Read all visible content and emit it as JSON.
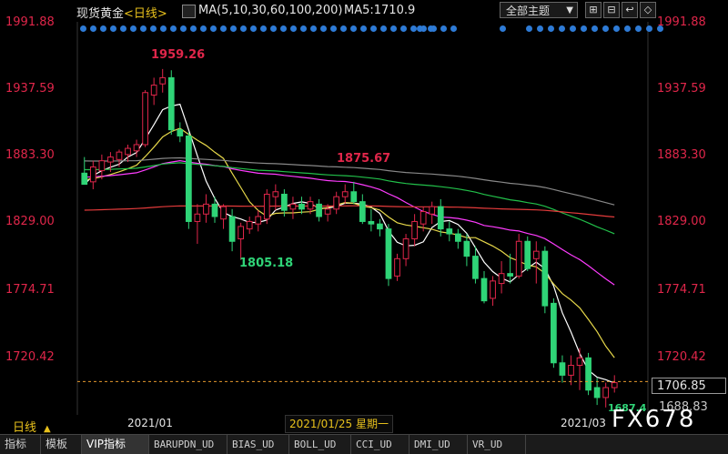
{
  "header": {
    "symbol": "现货黄金",
    "period_label": "<日线>",
    "ma_params": "MA(5,10,30,60,100,200)",
    "ma5_value": "MA5:1710.9",
    "theme_button": "全部主题",
    "tool_buttons": [
      "⊞",
      "⊟",
      "↩",
      "◇"
    ]
  },
  "y_axis": {
    "left_labels": [
      "1991.88",
      "1937.59",
      "1883.30",
      "1829.00",
      "1774.71",
      "1720.42"
    ],
    "right_labels": [
      "1991.88",
      "1937.59",
      "1883.30",
      "1829.00",
      "1774.71",
      "1720.42"
    ]
  },
  "current_price": "1706.85",
  "price_box_lower": "1688.83",
  "annotations": {
    "high": "1959.26",
    "mid_high": "1875.67",
    "low": "1805.18",
    "recent_low": "1687.4"
  },
  "x_axis": {
    "period_button": "日线",
    "date_labels": [
      "2021/01",
      "2021/03"
    ],
    "cursor_label": "2021/01/25 星期一"
  },
  "watermark": "FX678",
  "tabs": [
    "指标",
    "模板",
    "VIP指标",
    "BARUPDN_UD",
    "BIAS_UD",
    "BOLL_UD",
    "CCI_UD",
    "DMI_UD",
    "VR_UD"
  ],
  "active_tab": "VIP指标",
  "colors": {
    "up": "#e0264a",
    "down": "#2fd477",
    "ma5": "#ffffff",
    "ma10": "#e7d84a",
    "ma30": "#ff3cff",
    "ma60": "#22c04a",
    "ma100": "#888888",
    "ma200": "#e43b3b",
    "axis_text": "#e0264a"
  },
  "chart_data": {
    "type": "candlestick",
    "y_range": [
      1680,
      2000
    ],
    "candles": [
      {
        "o": 1875,
        "h": 1888,
        "l": 1868,
        "c": 1866
      },
      {
        "o": 1868,
        "h": 1885,
        "l": 1862,
        "c": 1880
      },
      {
        "o": 1877,
        "h": 1890,
        "l": 1870,
        "c": 1885
      },
      {
        "o": 1884,
        "h": 1892,
        "l": 1876,
        "c": 1888
      },
      {
        "o": 1886,
        "h": 1894,
        "l": 1880,
        "c": 1892
      },
      {
        "o": 1890,
        "h": 1898,
        "l": 1884,
        "c": 1895
      },
      {
        "o": 1893,
        "h": 1902,
        "l": 1888,
        "c": 1898
      },
      {
        "o": 1898,
        "h": 1942,
        "l": 1896,
        "c": 1940
      },
      {
        "o": 1938,
        "h": 1952,
        "l": 1930,
        "c": 1946
      },
      {
        "o": 1947,
        "h": 1959,
        "l": 1940,
        "c": 1952
      },
      {
        "o": 1952,
        "h": 1958,
        "l": 1906,
        "c": 1910
      },
      {
        "o": 1910,
        "h": 1916,
        "l": 1900,
        "c": 1905
      },
      {
        "o": 1905,
        "h": 1908,
        "l": 1830,
        "c": 1836
      },
      {
        "o": 1836,
        "h": 1850,
        "l": 1818,
        "c": 1842
      },
      {
        "o": 1842,
        "h": 1858,
        "l": 1835,
        "c": 1850
      },
      {
        "o": 1850,
        "h": 1856,
        "l": 1835,
        "c": 1840
      },
      {
        "o": 1838,
        "h": 1850,
        "l": 1830,
        "c": 1848
      },
      {
        "o": 1840,
        "h": 1846,
        "l": 1812,
        "c": 1820
      },
      {
        "o": 1822,
        "h": 1835,
        "l": 1805,
        "c": 1832
      },
      {
        "o": 1830,
        "h": 1840,
        "l": 1826,
        "c": 1836
      },
      {
        "o": 1834,
        "h": 1845,
        "l": 1828,
        "c": 1840
      },
      {
        "o": 1838,
        "h": 1862,
        "l": 1834,
        "c": 1858
      },
      {
        "o": 1856,
        "h": 1866,
        "l": 1845,
        "c": 1860
      },
      {
        "o": 1858,
        "h": 1862,
        "l": 1840,
        "c": 1845
      },
      {
        "o": 1846,
        "h": 1856,
        "l": 1838,
        "c": 1850
      },
      {
        "o": 1850,
        "h": 1856,
        "l": 1842,
        "c": 1846
      },
      {
        "o": 1846,
        "h": 1856,
        "l": 1842,
        "c": 1852
      },
      {
        "o": 1850,
        "h": 1854,
        "l": 1836,
        "c": 1840
      },
      {
        "o": 1842,
        "h": 1850,
        "l": 1836,
        "c": 1846
      },
      {
        "o": 1846,
        "h": 1860,
        "l": 1842,
        "c": 1856
      },
      {
        "o": 1856,
        "h": 1866,
        "l": 1850,
        "c": 1860
      },
      {
        "o": 1860,
        "h": 1868,
        "l": 1850,
        "c": 1852
      },
      {
        "o": 1852,
        "h": 1858,
        "l": 1834,
        "c": 1836
      },
      {
        "o": 1836,
        "h": 1846,
        "l": 1828,
        "c": 1834
      },
      {
        "o": 1834,
        "h": 1838,
        "l": 1824,
        "c": 1830
      },
      {
        "o": 1830,
        "h": 1834,
        "l": 1784,
        "c": 1790
      },
      {
        "o": 1792,
        "h": 1810,
        "l": 1788,
        "c": 1806
      },
      {
        "o": 1806,
        "h": 1826,
        "l": 1800,
        "c": 1822
      },
      {
        "o": 1822,
        "h": 1842,
        "l": 1816,
        "c": 1836
      },
      {
        "o": 1834,
        "h": 1848,
        "l": 1828,
        "c": 1844
      },
      {
        "o": 1842,
        "h": 1852,
        "l": 1834,
        "c": 1848
      },
      {
        "o": 1848,
        "h": 1854,
        "l": 1824,
        "c": 1830
      },
      {
        "o": 1830,
        "h": 1836,
        "l": 1820,
        "c": 1826
      },
      {
        "o": 1826,
        "h": 1830,
        "l": 1814,
        "c": 1820
      },
      {
        "o": 1820,
        "h": 1826,
        "l": 1800,
        "c": 1808
      },
      {
        "o": 1808,
        "h": 1816,
        "l": 1786,
        "c": 1790
      },
      {
        "o": 1790,
        "h": 1796,
        "l": 1770,
        "c": 1772
      },
      {
        "o": 1774,
        "h": 1792,
        "l": 1768,
        "c": 1788
      },
      {
        "o": 1786,
        "h": 1804,
        "l": 1778,
        "c": 1794
      },
      {
        "o": 1794,
        "h": 1810,
        "l": 1786,
        "c": 1792
      },
      {
        "o": 1792,
        "h": 1826,
        "l": 1790,
        "c": 1820
      },
      {
        "o": 1820,
        "h": 1824,
        "l": 1796,
        "c": 1798
      },
      {
        "o": 1806,
        "h": 1820,
        "l": 1786,
        "c": 1812
      },
      {
        "o": 1812,
        "h": 1816,
        "l": 1762,
        "c": 1768
      },
      {
        "o": 1770,
        "h": 1774,
        "l": 1718,
        "c": 1722
      },
      {
        "o": 1722,
        "h": 1728,
        "l": 1706,
        "c": 1712
      },
      {
        "o": 1712,
        "h": 1728,
        "l": 1704,
        "c": 1720
      },
      {
        "o": 1720,
        "h": 1734,
        "l": 1700,
        "c": 1726
      },
      {
        "o": 1726,
        "h": 1730,
        "l": 1696,
        "c": 1700
      },
      {
        "o": 1702,
        "h": 1710,
        "l": 1688,
        "c": 1694
      },
      {
        "o": 1694,
        "h": 1706,
        "l": 1686,
        "c": 1702
      },
      {
        "o": 1702,
        "h": 1712,
        "l": 1698,
        "c": 1706
      }
    ]
  }
}
